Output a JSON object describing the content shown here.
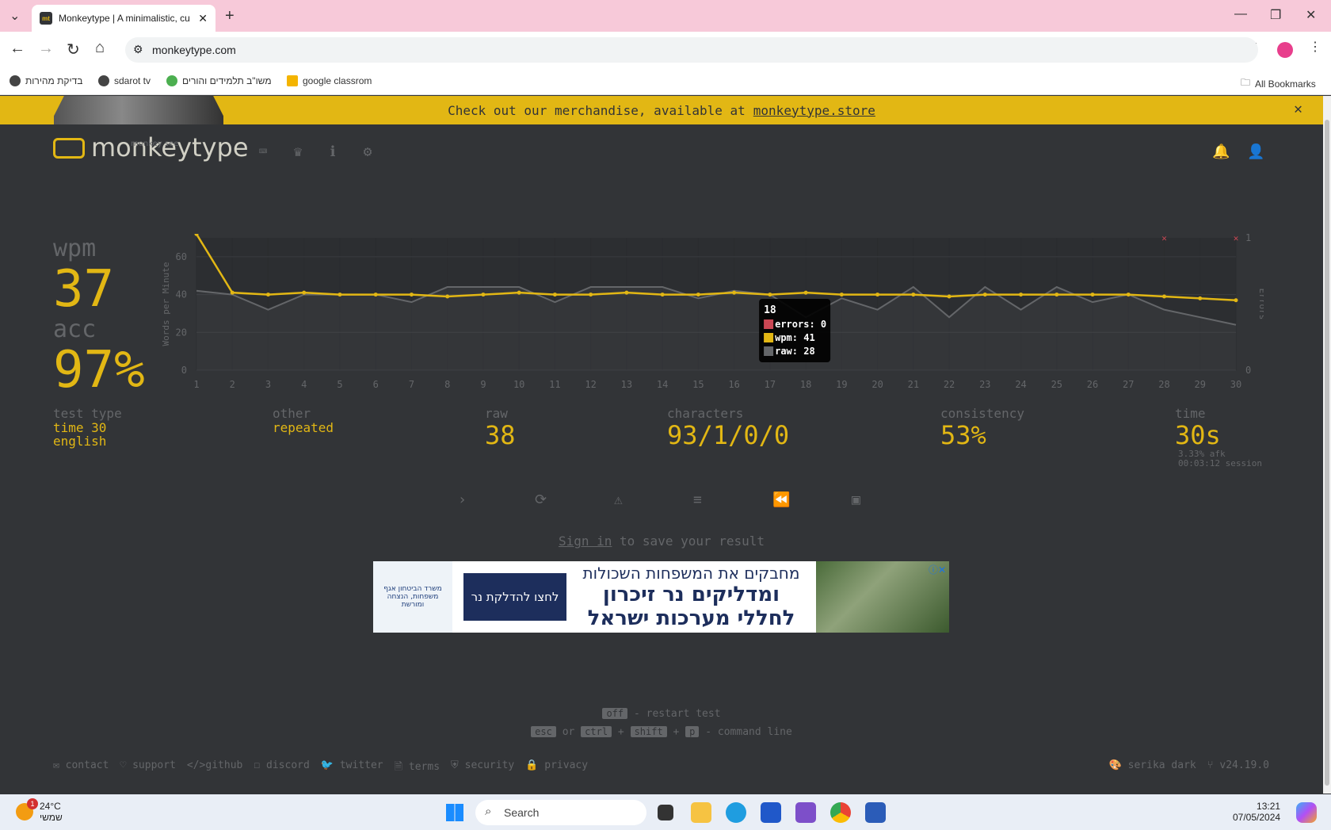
{
  "browser": {
    "tab_title": "Monkeytype | A minimalistic, cu",
    "url": "monkeytype.com",
    "bookmarks": [
      "בדיקת מהירות",
      "sdarot tv",
      "משו\"ב תלמידים והורים",
      "google classrom"
    ],
    "all_bookmarks": "All Bookmarks"
  },
  "banner": {
    "text": "Check out our merchandise, available at",
    "link": "monkeytype.store"
  },
  "logo": {
    "text": "monkeytype",
    "sub": "monkey see"
  },
  "results": {
    "wpm_label": "wpm",
    "wpm": "37",
    "acc_label": "acc",
    "acc": "97%",
    "test_type_label": "test type",
    "test_type_1": "time 30",
    "test_type_2": "english",
    "other_label": "other",
    "other": "repeated",
    "raw_label": "raw",
    "raw": "38",
    "characters_label": "characters",
    "characters": "93/1/0/0",
    "consistency_label": "consistency",
    "consistency": "53%",
    "time_label": "time",
    "time": "30s",
    "afk": "3.33% afk",
    "session": "00:03:12 session"
  },
  "signin": {
    "link": "Sign in",
    "rest": " to save your result"
  },
  "ad": {
    "line1": "מחבקים את המשפחות השכולות",
    "line2": "ומדליקים נר זיכרון",
    "line3": "לחללי מערכות ישראל",
    "button": "לחצו להדלקת נר",
    "org": "משרד הביטחון אגף משפחות, הנצחה ומורשת"
  },
  "hints": {
    "restart_key": "off",
    "restart_text": "- restart test",
    "esc": "esc",
    "or": "or",
    "ctrl": "ctrl",
    "shift": "shift",
    "p": "p",
    "cmd_text": "- command line"
  },
  "footer": {
    "contact": "contact",
    "support": "support",
    "github": "github",
    "discord": "discord",
    "twitter": "twitter",
    "terms": "terms",
    "security": "security",
    "privacy": "privacy",
    "theme": "serika dark",
    "version": "v24.19.0"
  },
  "taskbar": {
    "temp": "24°C",
    "weather": "שמשי",
    "search": "Search",
    "time": "13:21",
    "date": "07/05/2024",
    "badge": "1"
  },
  "colors": {
    "accent": "#e2b714",
    "bg": "#323437",
    "sub": "#646669",
    "text": "#d1d0c5",
    "error": "#ca4754"
  },
  "chart_data": {
    "type": "line",
    "x": [
      1,
      2,
      3,
      4,
      5,
      6,
      7,
      8,
      9,
      10,
      11,
      12,
      13,
      14,
      15,
      16,
      17,
      18,
      19,
      20,
      21,
      22,
      23,
      24,
      25,
      26,
      27,
      28,
      29,
      30
    ],
    "ylabel": "Words per Minute",
    "y2label": "Errors",
    "ylim": [
      0,
      70
    ],
    "y_ticks": [
      "0",
      "20",
      "40",
      "60"
    ],
    "y2_ticks": [
      "0",
      "1"
    ],
    "series": [
      {
        "name": "wpm",
        "color": "#e2b714",
        "values": [
          72,
          41,
          40,
          41,
          40,
          40,
          40,
          39,
          40,
          41,
          40,
          40,
          41,
          40,
          40,
          41,
          40,
          41,
          40,
          40,
          40,
          39,
          40,
          40,
          40,
          40,
          40,
          39,
          38,
          37
        ]
      },
      {
        "name": "raw",
        "color": "#646669",
        "values": [
          42,
          40,
          32,
          40,
          40,
          40,
          36,
          44,
          44,
          44,
          36,
          44,
          44,
          44,
          38,
          42,
          40,
          28,
          38,
          32,
          44,
          28,
          44,
          32,
          44,
          36,
          40,
          32,
          28,
          24
        ]
      },
      {
        "name": "errors",
        "color": "#ca4754",
        "error_points": [
          28,
          30
        ]
      }
    ],
    "tooltip": {
      "x": "18",
      "errors": "errors: 0",
      "wpm": "wpm: 41",
      "raw": "raw: 28"
    }
  }
}
